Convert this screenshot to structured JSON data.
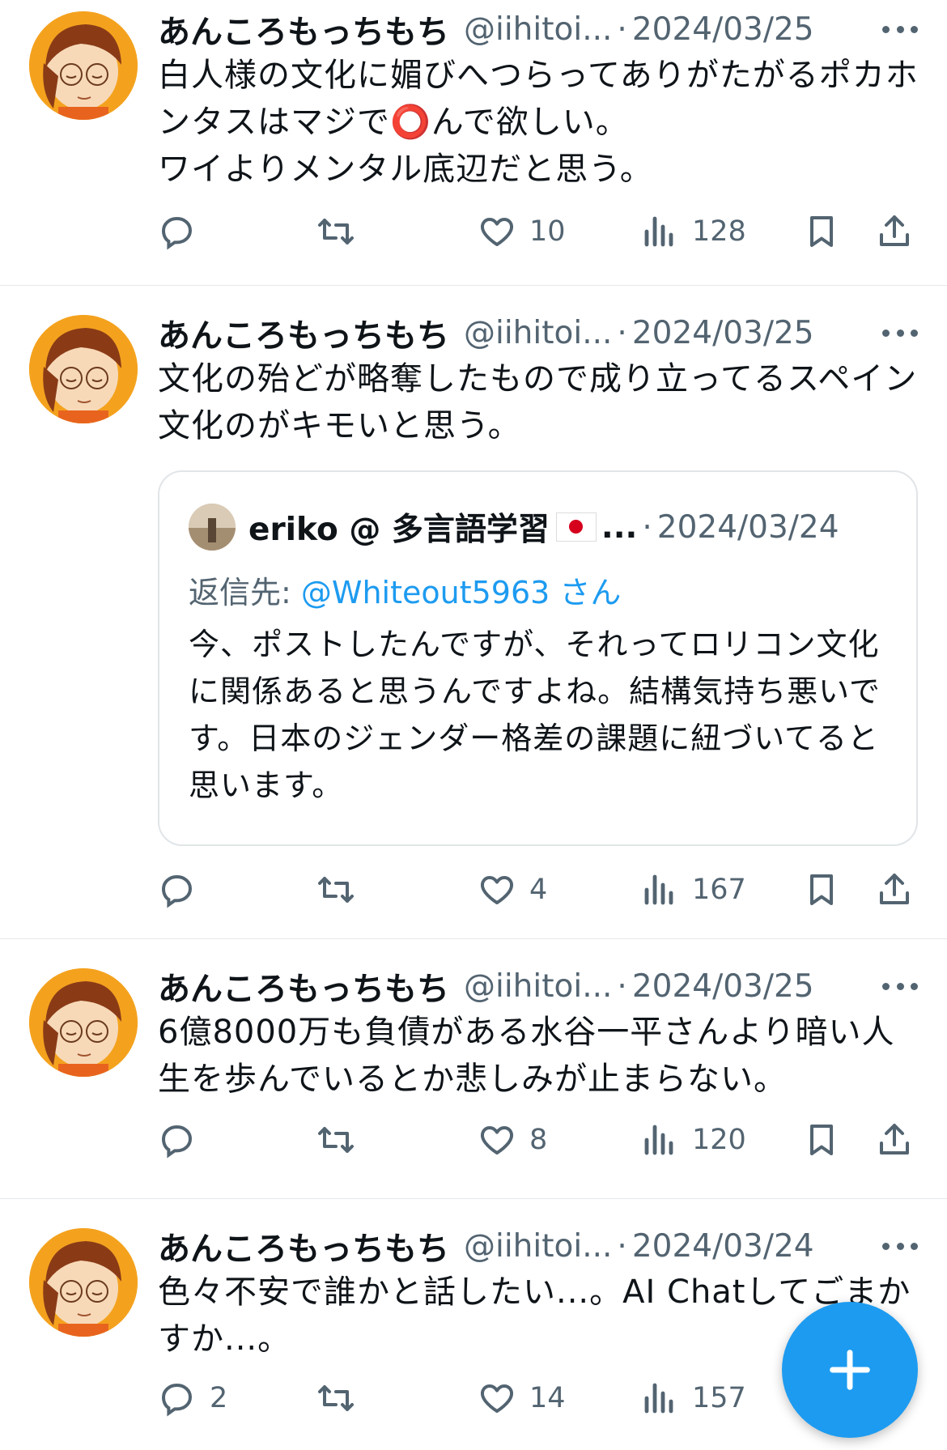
{
  "tweets": [
    {
      "name": "あんころもっちもち",
      "handle": "@iihitoi...",
      "date": "2024/03/25",
      "text": "白人様の文化に媚びへつらってありがたがるポカホンタスはマジで⭕️んで欲しい。\nワイよりメンタル底辺だと思う。",
      "replies": "",
      "retweets": "",
      "likes": "10",
      "views": "128"
    },
    {
      "name": "あんころもっちもち",
      "handle": "@iihitoi...",
      "date": "2024/03/25",
      "text": "文化の殆どが略奪したもので成り立ってるスペイン文化のがキモいと思う。",
      "replies": "",
      "retweets": "",
      "likes": "4",
      "views": "167",
      "quote": {
        "name": "eriko @ 多言語学習",
        "ellipsis": "...",
        "date": "2024/03/24",
        "replying_prefix": "返信先: ",
        "replying_to": "@Whiteout5963",
        "replying_suffix": " さん",
        "text": "今、ポストしたんですが、それってロリコン文化に関係あると思うんですよね。結構気持ち悪いです。日本のジェンダー格差の課題に紐づいてると思います。"
      }
    },
    {
      "name": "あんころもっちもち",
      "handle": "@iihitoi...",
      "date": "2024/03/25",
      "text": "6億8000万も負債がある水谷一平さんより暗い人生を歩んでいるとか悲しみが止まらない。",
      "replies": "",
      "retweets": "",
      "likes": "8",
      "views": "120"
    },
    {
      "name": "あんころもっちもち",
      "handle": "@iihitoi...",
      "date": "2024/03/24",
      "text": "色々不安で誰かと話したい...。AI Chatしてごまかすか...。",
      "replies": "2",
      "retweets": "",
      "likes": "14",
      "views": "157"
    }
  ],
  "colors": {
    "text": "#0f1419",
    "secondary": "#536471",
    "accent": "#1d9bf0",
    "divider": "#e6e9ec"
  },
  "icons": [
    "reply-icon",
    "retweet-icon",
    "like-icon",
    "views-icon",
    "bookmark-icon",
    "share-icon",
    "more-icon",
    "compose-icon"
  ]
}
